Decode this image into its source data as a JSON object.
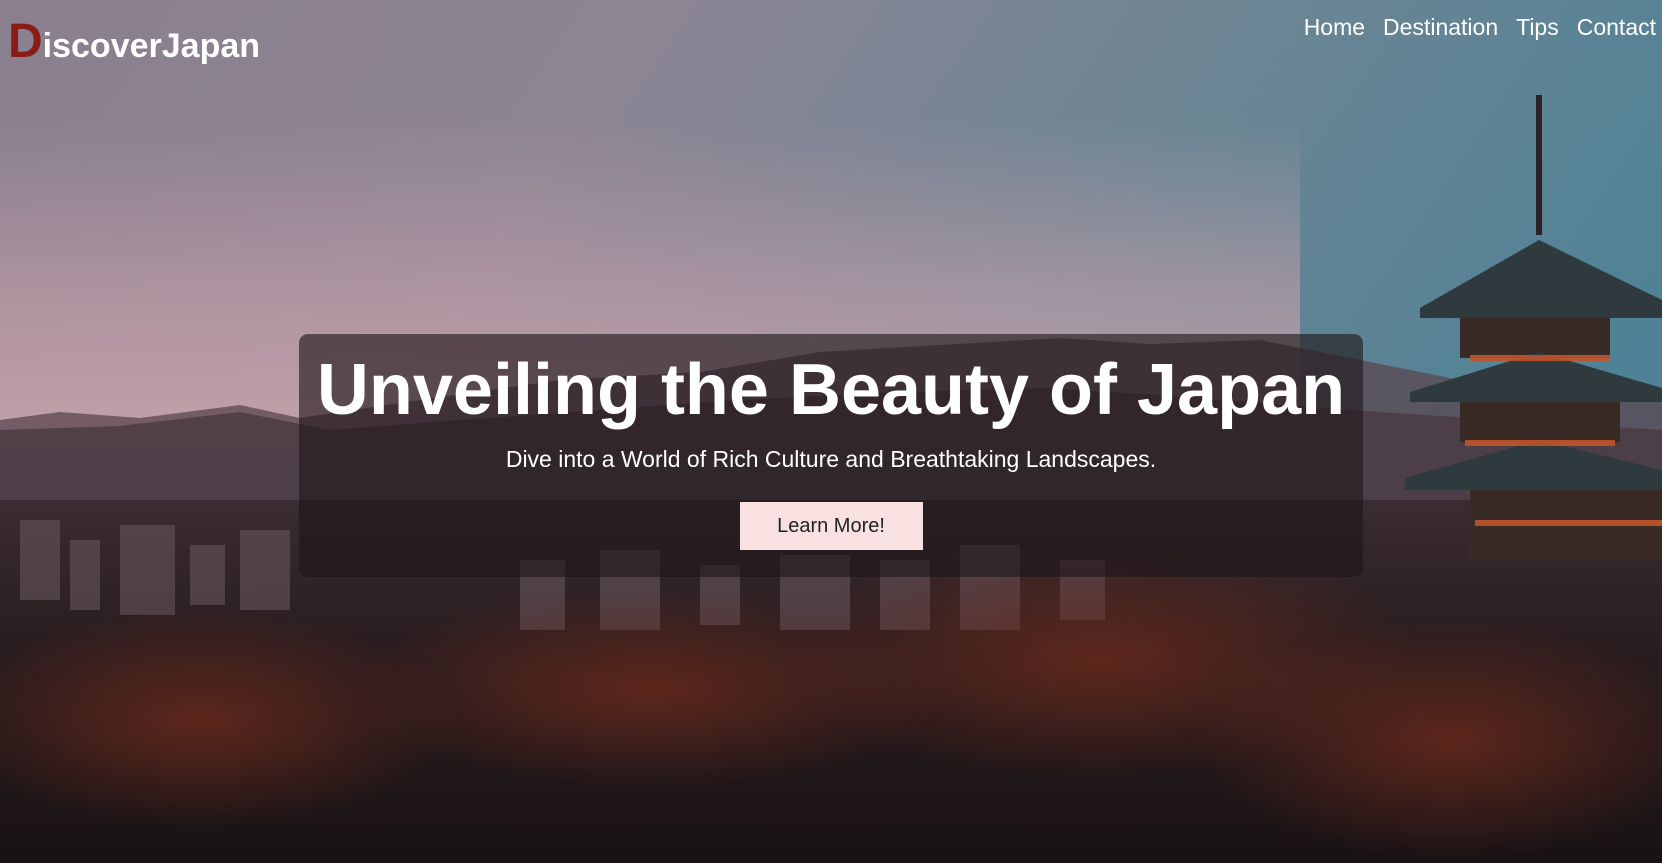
{
  "header": {
    "logo_initial": "D",
    "logo_rest": "iscoverJapan",
    "nav": [
      {
        "label": "Home"
      },
      {
        "label": "Destination"
      },
      {
        "label": "Tips"
      },
      {
        "label": "Contact"
      }
    ]
  },
  "hero": {
    "title": "Unveiling the Beauty of Japan",
    "subtitle": "Dive into a World of Rich Culture and Breathtaking Landscapes.",
    "cta_label": "Learn More!"
  },
  "colors": {
    "logo_accent": "#8a1c18",
    "button_bg": "#f9e1e2",
    "card_bg": "rgba(30,22,26,0.62)"
  }
}
